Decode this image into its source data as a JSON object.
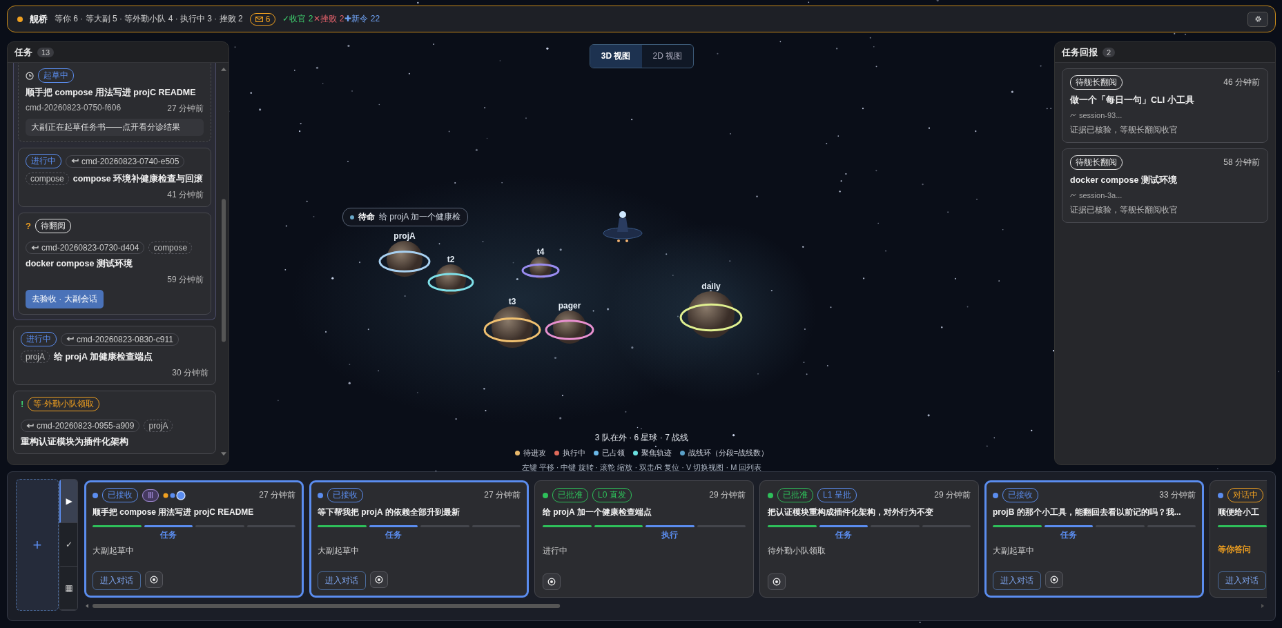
{
  "topbar": {
    "title": "舰桥",
    "summary": "等你 6 · 等大副 5 · 等外勤小队 4 · 执行中 3 · 挫败 2",
    "mail_count": "6",
    "tallies": [
      {
        "text": "✓收官 2",
        "color": "#3ecf6e"
      },
      {
        "text": "✕挫败 2",
        "color": "#e0606a"
      },
      {
        "text": "✚新令 22",
        "color": "#6ea0f0"
      }
    ]
  },
  "tasks": {
    "title": "任务",
    "count": "13",
    "items": [
      {
        "kind": "group",
        "children": [
          {
            "kind": "draft",
            "badge": {
              "text": "起草中",
              "color": "#5b8def"
            },
            "title": "顺手把 compose 用法写进 projC README",
            "id": "cmd-20260823-0750-f606",
            "time": "27 分钟前",
            "note": "大副正在起草任务书——点开看分诊结果"
          },
          {
            "kind": "task",
            "badge": {
              "text": "进行中",
              "color": "#5b8def"
            },
            "ref": "cmd-20260823-0740-e505",
            "tag": "compose",
            "title": "compose 环境补健康检查与回滚",
            "time": "41 分钟前"
          },
          {
            "kind": "task",
            "mark": {
              "text": "?",
              "color": "#f0a020"
            },
            "badge": {
              "text": "待翻阅",
              "color": "#e8e8e8"
            },
            "ref": "cmd-20260823-0730-d404",
            "tag": "compose",
            "title": "docker compose 测试环境",
            "time": "59 分钟前",
            "action": "去验收 · 大副会话"
          }
        ]
      },
      {
        "kind": "task",
        "badge": {
          "text": "进行中",
          "color": "#5b8def"
        },
        "ref": "cmd-20260823-0830-c911",
        "tag": "projA",
        "title": "给 projA 加健康检查端点",
        "time": "30 分钟前"
      },
      {
        "kind": "task",
        "mark": {
          "text": "!",
          "color": "#3ecf6e"
        },
        "badge": {
          "text": "等·外勤小队领取",
          "color": "#f0a020"
        },
        "ref": "cmd-20260823-0955-a909",
        "tag": "projA",
        "title": "重构认证模块为插件化架构"
      }
    ]
  },
  "view_toggle": [
    {
      "label": "3D 视图",
      "selected": true
    },
    {
      "label": "2D 视图",
      "selected": false
    }
  ],
  "scene": {
    "planets": [
      {
        "label": "projA",
        "color": "#a8d0f0"
      },
      {
        "label": "t2",
        "color": "#7fe0e8"
      },
      {
        "label": "t4",
        "color": "#9a8cf0"
      },
      {
        "label": "t3",
        "color": "#f0c070"
      },
      {
        "label": "pager",
        "color": "#e890d0"
      },
      {
        "label": "daily",
        "color": "#e0f090"
      }
    ],
    "tooltip": {
      "status": "待命",
      "text": "给 projA 加一个健康检"
    },
    "stats": "3 队在外 · 6 星球 · 7 战线",
    "legend": [
      {
        "label": "待进攻",
        "color": "#e8b86a"
      },
      {
        "label": "执行中",
        "color": "#e06a5a"
      },
      {
        "label": "已占领",
        "color": "#6ab8e8"
      },
      {
        "label": "聚焦轨迹",
        "color": "#6ae0e0"
      },
      {
        "label": "战线环（分段=战线数）",
        "color": "#5aa0c8"
      }
    ],
    "hint": "左键 平移 · 中键 旋转 · 滚轮 缩放 · 双击/R 复位 · V 切换视图 · M 回列表"
  },
  "reports": {
    "title": "任务回报",
    "count": "2",
    "items": [
      {
        "badge": "待舰长翻阅",
        "time": "46 分钟前",
        "title": "做一个「每日一句」CLI 小工具",
        "session": "session-93...",
        "note": "证据已核验，等舰长翻阅收官"
      },
      {
        "badge": "待舰长翻阅",
        "time": "58 分钟前",
        "title": "docker compose 测试环境",
        "session": "session-3a...",
        "note": "证据已核验，等舰长翻阅收官"
      }
    ]
  },
  "dock": {
    "add_label": "+",
    "rail": [
      {
        "glyph": "▶",
        "selected": true
      },
      {
        "glyph": "✓",
        "selected": false
      },
      {
        "glyph": "▦",
        "selected": false
      }
    ],
    "cards": [
      {
        "selected": true,
        "color": "#5b8def",
        "badges": [
          {
            "text": "已接收",
            "color": "#5b8def",
            "kind": "outline"
          },
          {
            "text": "Ⅲ",
            "color": "#a890e0",
            "kind": "filled"
          }
        ],
        "crew_dots": true,
        "time": "27 分钟前",
        "title": "顺手把 compose 用法写进 projC README",
        "progress": [
          {
            "done": true,
            "current": false
          },
          {
            "done": false,
            "current": true
          },
          {
            "done": false,
            "current": false
          },
          {
            "done": false,
            "current": false
          }
        ],
        "stage": "任务",
        "desc": {
          "text": "大副起草中",
          "alert": false
        },
        "chat": "进入对话"
      },
      {
        "selected": true,
        "color": "#5b8def",
        "badges": [
          {
            "text": "已接收",
            "color": "#5b8def",
            "kind": "outline"
          }
        ],
        "time": "27 分钟前",
        "title": "等下帮我把 projA 的依赖全部升到最新",
        "progress": [
          {
            "done": true,
            "current": false
          },
          {
            "done": false,
            "current": true
          },
          {
            "done": false,
            "current": false
          },
          {
            "done": false,
            "current": false
          }
        ],
        "stage": "任务",
        "desc": {
          "text": "大副起草中",
          "alert": false
        },
        "chat": "进入对话"
      },
      {
        "selected": false,
        "color": "#2ec05a",
        "badges": [
          {
            "text": "已批准",
            "color": "#2ec05a",
            "kind": "outline"
          },
          {
            "text": "L0 直发",
            "color": "#2ec05a",
            "kind": "outline"
          }
        ],
        "time": "29 分钟前",
        "title": "给 projA 加一个健康检查端点",
        "progress": [
          {
            "done": true,
            "current": false
          },
          {
            "done": true,
            "current": false
          },
          {
            "done": false,
            "current": true
          },
          {
            "done": false,
            "current": false
          }
        ],
        "stage": "执行",
        "desc": {
          "text": "进行中",
          "alert": false
        }
      },
      {
        "selected": false,
        "color": "#2ec05a",
        "badges": [
          {
            "text": "已批准",
            "color": "#2ec05a",
            "kind": "outline"
          },
          {
            "text": "L1 呈批",
            "color": "#5b8def",
            "kind": "outline"
          }
        ],
        "time": "29 分钟前",
        "title": "把认证模块重构成插件化架构，对外行为不变",
        "progress": [
          {
            "done": true,
            "current": false
          },
          {
            "done": false,
            "current": true
          },
          {
            "done": false,
            "current": false
          },
          {
            "done": false,
            "current": false
          }
        ],
        "stage": "任务",
        "desc": {
          "text": "待外勤小队领取",
          "alert": false
        }
      },
      {
        "selected": true,
        "color": "#5b8def",
        "badges": [
          {
            "text": "已接收",
            "color": "#5b8def",
            "kind": "outline"
          }
        ],
        "time": "33 分钟前",
        "title": "projB 的那个小工具，能翻回去看以前记的吗？我...",
        "progress": [
          {
            "done": true,
            "current": false
          },
          {
            "done": false,
            "current": true
          },
          {
            "done": false,
            "current": false
          },
          {
            "done": false,
            "current": false
          }
        ],
        "stage": "任务",
        "desc": {
          "text": "大副起草中",
          "alert": false
        },
        "chat": "进入对话"
      },
      {
        "selected": false,
        "color": "#5b8def",
        "badges": [
          {
            "text": "对话中",
            "color": "#f0a020",
            "kind": "outline"
          }
        ],
        "title": "顺便给小工",
        "progress": [
          {
            "done": true,
            "current": false
          }
        ],
        "desc": {
          "text": "等你答问",
          "alert": true
        },
        "chat": "进入对话"
      }
    ]
  }
}
